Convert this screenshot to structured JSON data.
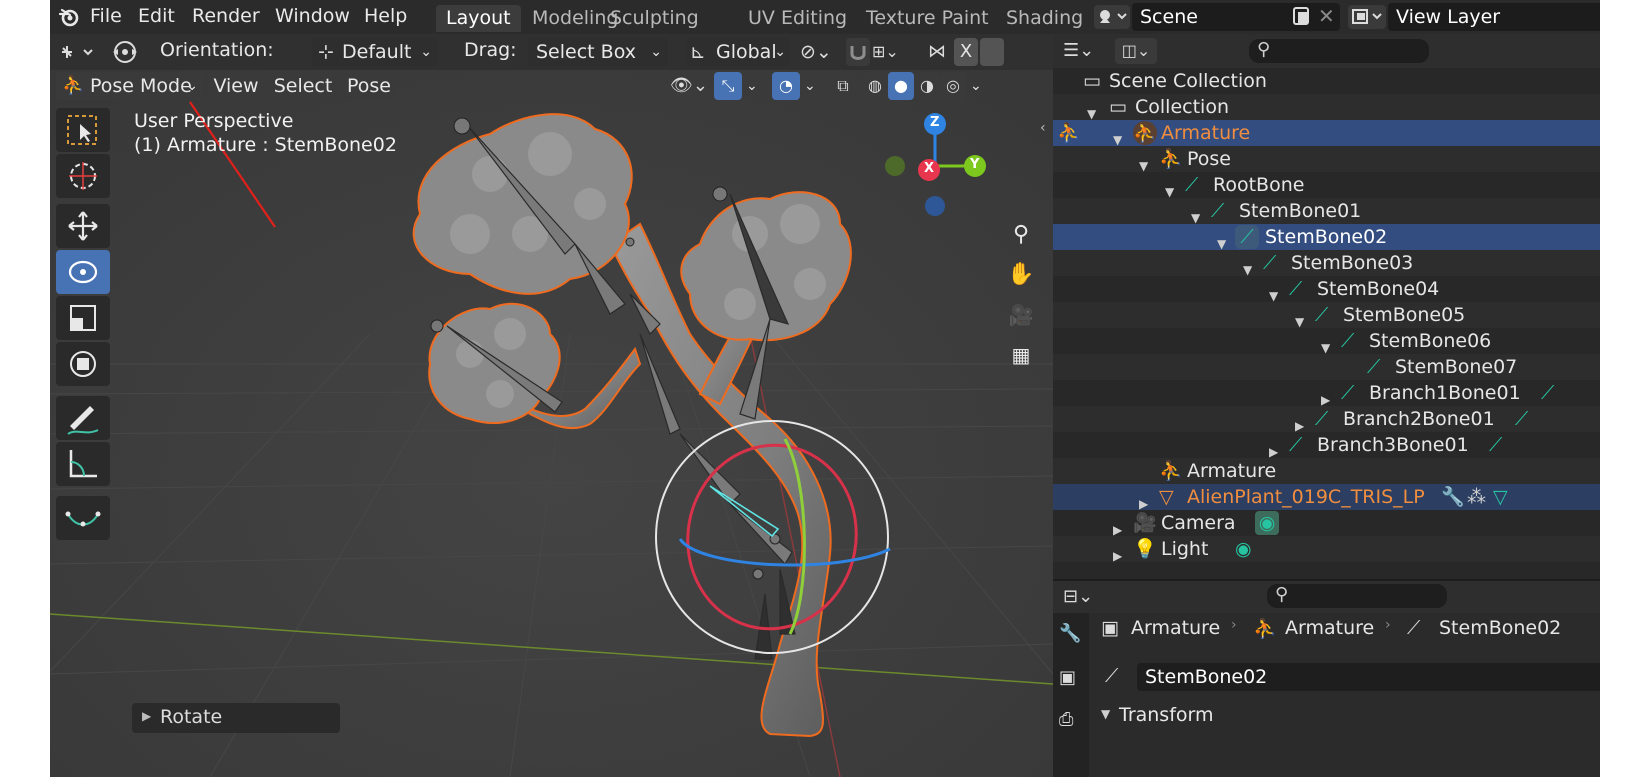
{
  "menu": [
    "File",
    "Edit",
    "Render",
    "Window",
    "Help"
  ],
  "workspaces": [
    "Layout",
    "Modeling",
    "Sculpting",
    "UV Editing",
    "Texture Paint",
    "Shading"
  ],
  "active_workspace": "Layout",
  "scene": {
    "name": "Scene",
    "view_layer": "View Layer"
  },
  "viewport_header": {
    "orientation_label": "Orientation:",
    "orientation_value": "Default",
    "drag_label": "Drag:",
    "drag_value": "Select Box",
    "transform_space": "Global"
  },
  "viewport_menu": {
    "mode": "Pose Mode",
    "view": "View",
    "select": "Select",
    "pose": "Pose"
  },
  "overlay": {
    "perspective": "User Perspective",
    "context": "(1) Armature : StemBone02"
  },
  "gizmo": {
    "z": "Z",
    "x": "X",
    "y": "Y"
  },
  "last_operator": "Rotate",
  "outliner": {
    "rows": [
      {
        "label": "Scene Collection",
        "depth": 0,
        "icon": "scene-collection-icon"
      },
      {
        "label": "Collection",
        "depth": 1,
        "icon": "collection-icon"
      },
      {
        "label": "Armature",
        "depth": 2,
        "icon": "armature-icon",
        "state": "active"
      },
      {
        "label": "Pose",
        "depth": 3,
        "icon": "pose-icon"
      },
      {
        "label": "RootBone",
        "depth": 4,
        "icon": "bone-icon"
      },
      {
        "label": "StemBone01",
        "depth": 5,
        "icon": "bone-icon"
      },
      {
        "label": "StemBone02",
        "depth": 6,
        "icon": "bone-icon",
        "state": "selected"
      },
      {
        "label": "StemBone03",
        "depth": 7,
        "icon": "bone-icon"
      },
      {
        "label": "StemBone04",
        "depth": 8,
        "icon": "bone-icon"
      },
      {
        "label": "StemBone05",
        "depth": 9,
        "icon": "bone-icon"
      },
      {
        "label": "StemBone06",
        "depth": 10,
        "icon": "bone-icon"
      },
      {
        "label": "StemBone07",
        "depth": 11,
        "icon": "bone-icon"
      },
      {
        "label": "Branch1Bone01",
        "depth": 10,
        "icon": "bone-icon"
      },
      {
        "label": "Branch2Bone01",
        "depth": 9,
        "icon": "bone-icon"
      },
      {
        "label": "Branch3Bone01",
        "depth": 8,
        "icon": "bone-icon"
      },
      {
        "label": "Armature",
        "depth": 3,
        "icon": "armature-data-icon"
      },
      {
        "label": "AlienPlant_019C_TRIS_LP",
        "depth": 2,
        "icon": "mesh-icon",
        "state": "highlight"
      },
      {
        "label": "Camera",
        "depth": 2,
        "icon": "camera-icon"
      },
      {
        "label": "Light",
        "depth": 2,
        "icon": "light-icon"
      }
    ]
  },
  "properties": {
    "breadcrumb": [
      "Armature",
      "Armature",
      "StemBone02"
    ],
    "bone_name": "StemBone02",
    "panel": "Transform"
  },
  "colors": {
    "selection_blue": "#334d80",
    "active_orange": "#f08d3e",
    "bone_teal": "#26c4a0",
    "axis_x": "#e8364f",
    "axis_y": "#7cc81f",
    "axis_z": "#2f84e3"
  }
}
